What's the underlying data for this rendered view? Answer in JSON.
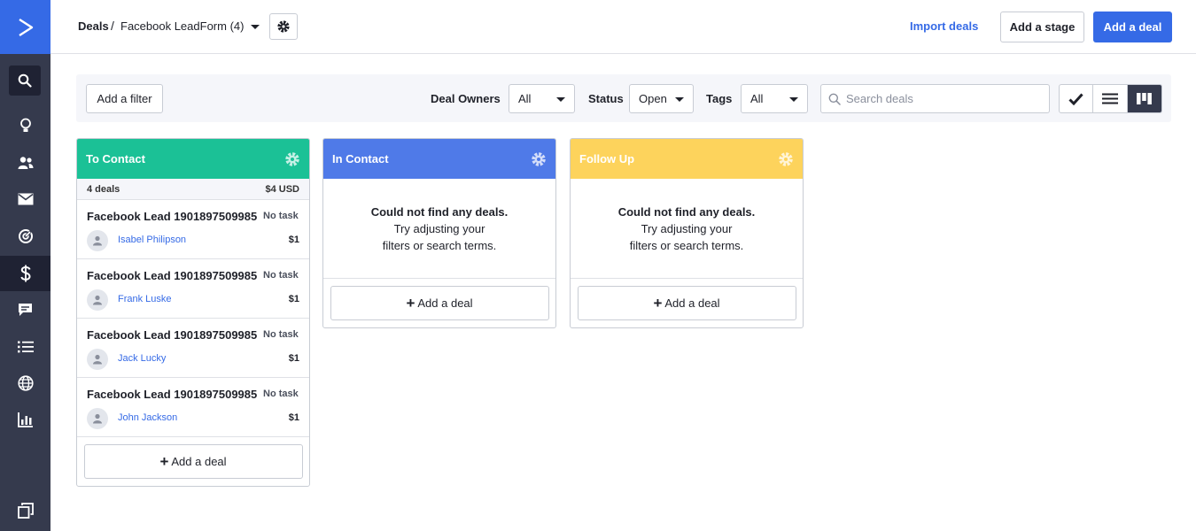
{
  "header": {
    "breadcrumb_root": "Deals",
    "breadcrumb_sep": "/",
    "pipeline_name": "Facebook LeadForm (4)",
    "import_label": "Import deals",
    "add_stage_label": "Add a stage",
    "add_deal_label": "Add a deal"
  },
  "filters": {
    "add_filter_label": "Add a filter",
    "deal_owners_label": "Deal Owners",
    "deal_owners_value": "All",
    "status_label": "Status",
    "status_value": "Open",
    "tags_label": "Tags",
    "tags_value": "All",
    "search_placeholder": "Search deals"
  },
  "columns": [
    {
      "title": "To Contact",
      "color": "#1bc196",
      "count_label": "4 deals",
      "total": "$4 USD",
      "add_label": "Add a deal",
      "cards": [
        {
          "title": "Facebook Lead 1901897509985",
          "task": "No task",
          "person": "Isabel Philipson",
          "value": "$1"
        },
        {
          "title": "Facebook Lead 1901897509985",
          "task": "No task",
          "person": "Frank Luske",
          "value": "$1"
        },
        {
          "title": "Facebook Lead 1901897509985",
          "task": "No task",
          "person": "Jack Lucky",
          "value": "$1"
        },
        {
          "title": "Facebook Lead 1901897509985",
          "task": "No task",
          "person": "John Jackson",
          "value": "$1"
        }
      ]
    },
    {
      "title": "In Contact",
      "color": "#4f7ae8",
      "empty_line1": "Could not find any deals.",
      "empty_line2": "Try adjusting your",
      "empty_line3": "filters or search terms.",
      "add_label": "Add a deal"
    },
    {
      "title": "Follow Up",
      "color": "#fdd35c",
      "empty_line1": "Could not find any deals.",
      "empty_line2": "Try adjusting your",
      "empty_line3": "filters or search terms.",
      "add_label": "Add a deal"
    }
  ],
  "colors": {
    "brand": "#356ae6",
    "sidebar": "#353a4d"
  },
  "icons": [
    "logo-chevron-icon",
    "search-icon",
    "lightbulb-icon",
    "contacts-icon",
    "email-icon",
    "automation-icon",
    "dollar-icon",
    "conversations-icon",
    "list-icon",
    "globe-icon",
    "reports-icon",
    "pages-icon",
    "gear-icon",
    "check-icon",
    "list-view-icon",
    "kanban-icon",
    "user-icon",
    "plus-icon"
  ]
}
